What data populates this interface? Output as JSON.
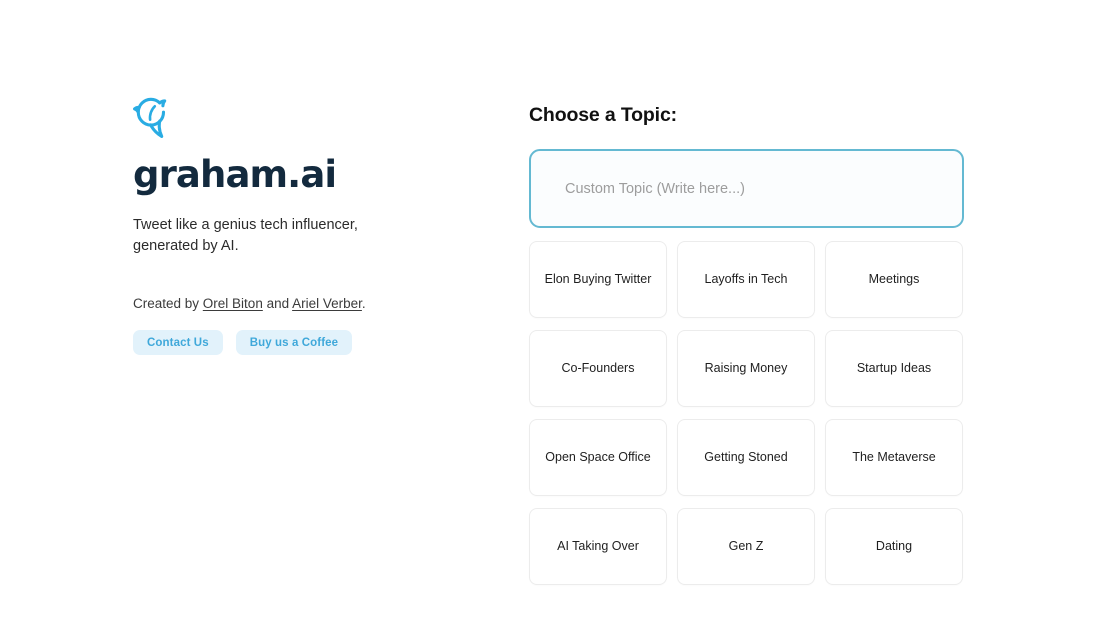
{
  "brand": {
    "logo_icon": "bird-icon",
    "logo_color": "#29ace3",
    "wordmark": "graham.ai",
    "wordmark_color": "#132a3e",
    "tagline": "Tweet like a genius tech influencer, generated by AI."
  },
  "credit": {
    "prefix": "Created by ",
    "author_one": "Orel Biton",
    "separator": " and ",
    "author_two": "Ariel Verber",
    "suffix": "."
  },
  "actions": {
    "contact_label": "Contact Us",
    "coffee_label": "Buy us a Coffee",
    "pill_bg": "#e2f2fb",
    "pill_text_color": "#3fa8da"
  },
  "topics_panel": {
    "title": "Choose a Topic:",
    "custom_input": {
      "value": "",
      "placeholder": "Custom Topic (Write here...)",
      "border_color": "#64b9d2"
    },
    "cards": [
      {
        "label": "Elon Buying Twitter"
      },
      {
        "label": "Layoffs in Tech"
      },
      {
        "label": "Meetings"
      },
      {
        "label": "Co-Founders"
      },
      {
        "label": "Raising Money"
      },
      {
        "label": "Startup Ideas"
      },
      {
        "label": "Open Space Office"
      },
      {
        "label": "Getting Stoned"
      },
      {
        "label": "The Metaverse"
      },
      {
        "label": "AI Taking Over"
      },
      {
        "label": "Gen Z"
      },
      {
        "label": "Dating"
      }
    ]
  }
}
